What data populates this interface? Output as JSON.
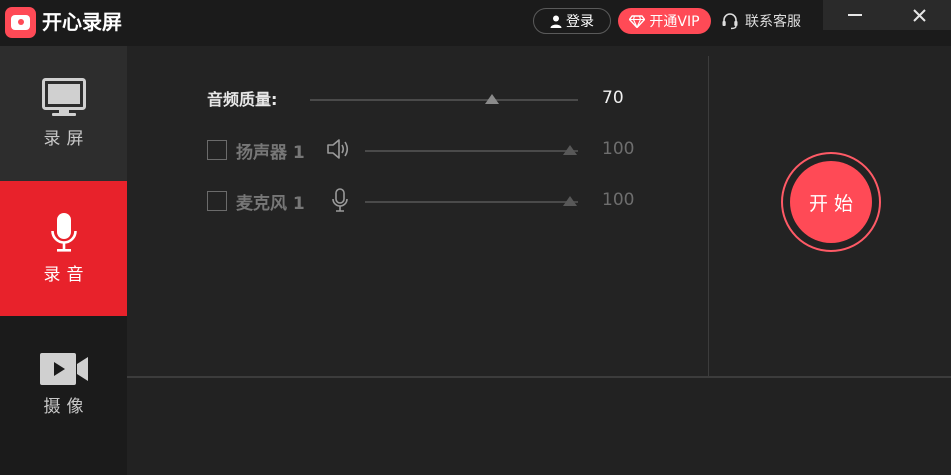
{
  "app": {
    "title": "开心录屏",
    "accent_color": "#ff4a56",
    "sidebar_active_color": "#e8222b"
  },
  "header": {
    "login_label": "登录",
    "vip_label": "开通VIP",
    "service_label": "联系客服",
    "login_icon": "user-icon",
    "vip_icon": "diamond-icon",
    "service_icon": "headset-icon"
  },
  "sidebar": {
    "items": [
      {
        "label": "录屏",
        "icon": "monitor-icon",
        "active": false
      },
      {
        "label": "录音",
        "icon": "microphone-icon",
        "active": true
      },
      {
        "label": "摄像",
        "icon": "camera-icon",
        "active": false
      }
    ]
  },
  "audio": {
    "quality": {
      "label": "音频质量:",
      "value": "70",
      "fraction": 0.7
    },
    "speaker": {
      "label": "扬声器 1",
      "value": "100",
      "fraction": 1.0,
      "checked": false,
      "icon": "speaker-icon"
    },
    "microphone": {
      "label": "麦克风 1",
      "value": "100",
      "fraction": 1.0,
      "checked": false,
      "icon": "microphone-icon"
    }
  },
  "start": {
    "label": "开始"
  }
}
